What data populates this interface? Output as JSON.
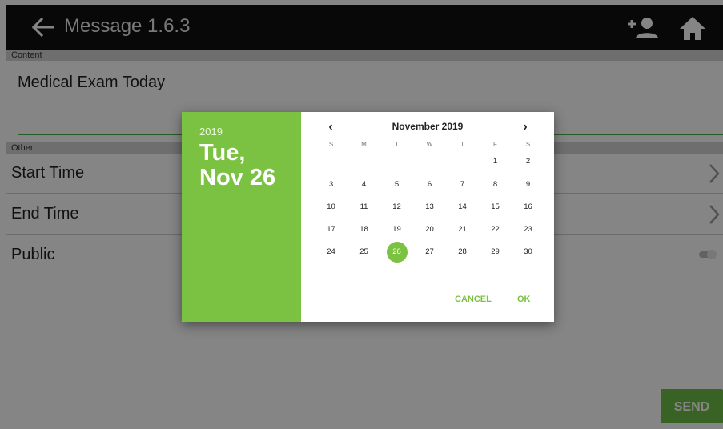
{
  "appbar": {
    "title": "Message 1.6.3"
  },
  "form": {
    "content_header": "Content",
    "content_value": "Medical Exam Today",
    "other_header": "Other",
    "rows": [
      {
        "label": "Start Time"
      },
      {
        "label": "End Time"
      },
      {
        "label": "Public"
      }
    ],
    "send_label": "SEND"
  },
  "dialog": {
    "year": "2019",
    "date_label": "Tue, Nov 26",
    "month_title": "November 2019",
    "weekdays": [
      "S",
      "M",
      "T",
      "W",
      "T",
      "F",
      "S"
    ],
    "days": [
      "1",
      "2",
      "3",
      "4",
      "5",
      "6",
      "7",
      "8",
      "9",
      "10",
      "11",
      "12",
      "13",
      "14",
      "15",
      "16",
      "17",
      "18",
      "19",
      "20",
      "21",
      "22",
      "23",
      "24",
      "25",
      "26",
      "27",
      "28",
      "29",
      "30"
    ],
    "selected_day": "26",
    "cancel_label": "CANCEL",
    "ok_label": "OK"
  },
  "colors": {
    "accent": "#7cc242",
    "appbar": "#111111",
    "send_button": "#6cbf45",
    "underline": "#4caf50"
  }
}
